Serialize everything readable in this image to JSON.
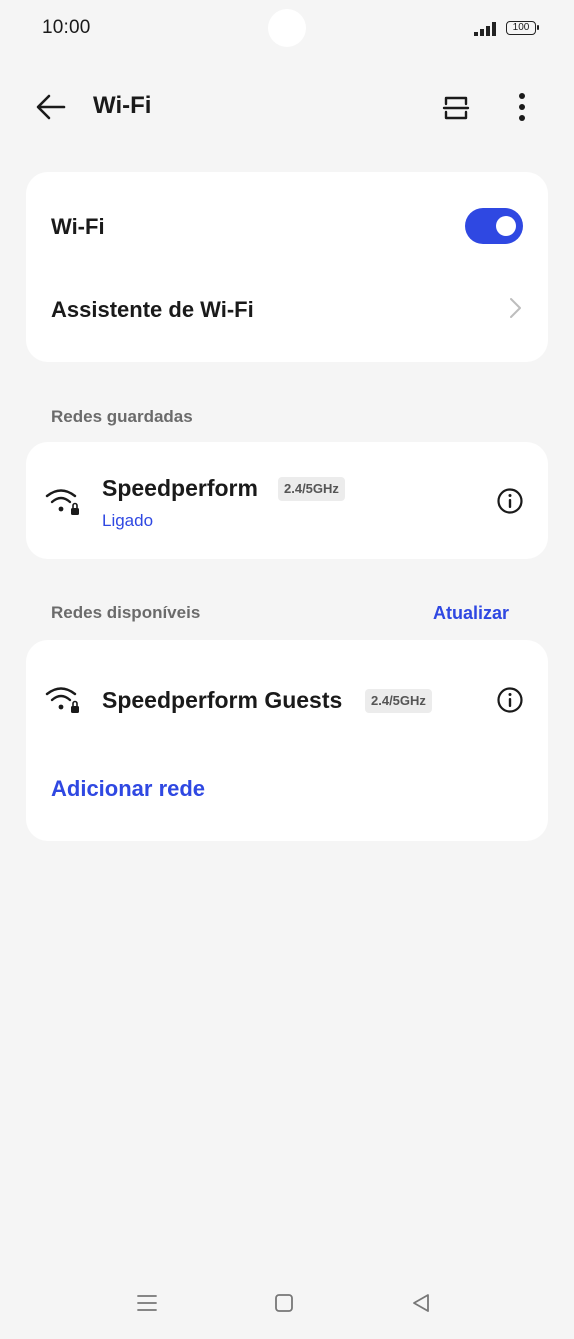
{
  "status_bar": {
    "time": "10:00",
    "battery": "100"
  },
  "app_bar": {
    "title": "Wi-Fi"
  },
  "wifi_card": {
    "wifi_label": "Wi-Fi",
    "wifi_enabled": true,
    "assistant_label": "Assistente de Wi-Fi"
  },
  "saved_networks": {
    "header": "Redes guardadas",
    "items": [
      {
        "name": "Speedperform",
        "band": "2.4/5GHz",
        "status": "Ligado"
      }
    ]
  },
  "available_networks": {
    "header": "Redes disponíveis",
    "refresh_label": "Atualizar",
    "items": [
      {
        "name": "Speedperform Guests",
        "band": "2.4/5GHz"
      }
    ],
    "add_label": "Adicionar rede"
  },
  "colors": {
    "accent": "#2f48e2",
    "background": "#f5f5f5",
    "card": "#ffffff"
  },
  "icons": [
    "back-arrow-icon",
    "scan-icon",
    "more-vert-icon",
    "wifi-lock-icon",
    "info-icon",
    "chevron-right-icon",
    "menu-icon",
    "home-square-icon",
    "back-triangle-icon"
  ]
}
